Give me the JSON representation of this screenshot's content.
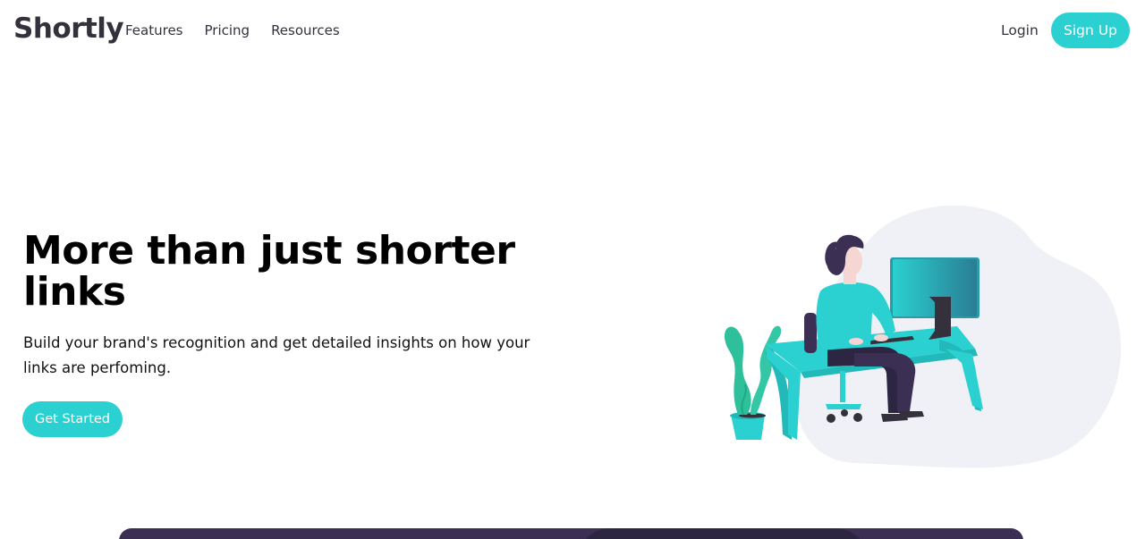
{
  "nav": {
    "logo": "Shortly",
    "links": [
      "Features",
      "Pricing",
      "Resources"
    ],
    "login": "Login",
    "signup": "Sign Up"
  },
  "hero": {
    "title": "More than just shorter links",
    "subtitle": "Build your brand's recognition and get detailed insights on how your links are perfoming.",
    "cta": "Get Started"
  },
  "illustration": {
    "icon": "person-working-at-desk-illustration"
  },
  "colors": {
    "primary": "#2bd0d0",
    "dark_violet": "#3b3054",
    "text": "#34313d",
    "blob": "#f0f1f6"
  }
}
